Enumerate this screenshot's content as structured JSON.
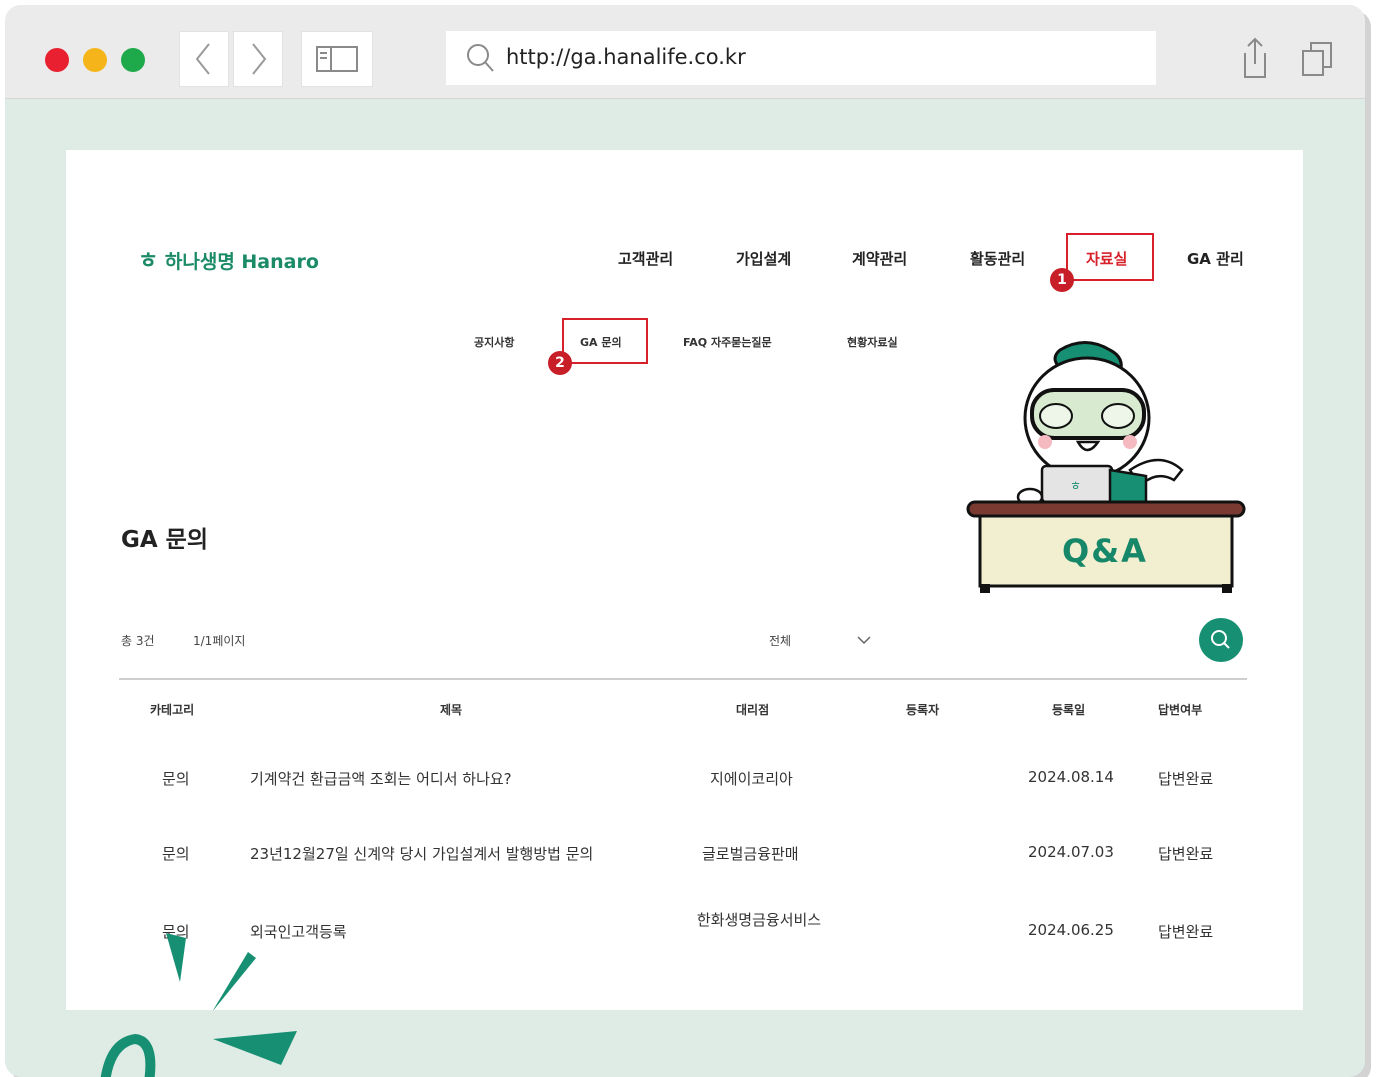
{
  "browser": {
    "url": "http://ga.hanalife.co.kr",
    "traffic_colors": [
      "#e8202f",
      "#f5b51a",
      "#1ea94b"
    ]
  },
  "site": {
    "logo_text": "하나생명 Hanaro",
    "nav": [
      "고객관리",
      "가입설계",
      "계약관리",
      "활동관리",
      "자료실",
      "GA 관리"
    ],
    "subnav": [
      "공지사항",
      "GA 문의",
      "FAQ 자주묻는질문",
      "현황자료실"
    ]
  },
  "markers": {
    "step1": "1",
    "step2": "2"
  },
  "board": {
    "title": "GA 문의",
    "total": "총 3건",
    "pages": "1/1페이지",
    "filter": "전체",
    "columns": [
      "카테고리",
      "제목",
      "대리점",
      "등록자",
      "등록일",
      "답변여부"
    ],
    "rows": [
      {
        "category": "문의",
        "subject": "기계약건 환급금액 조회는 어디서 하나요?",
        "agency": "지에이코리아",
        "writer": "",
        "date": "2024.08.14",
        "status": "답변완료"
      },
      {
        "category": "문의",
        "subject": "23년12월27일 신계약 당시 가입설계서 발행방법 문의",
        "agency": "글로벌금융판매",
        "writer": "",
        "date": "2024.07.03",
        "status": "답변완료"
      },
      {
        "category": "문의",
        "subject": "외국인고객등록",
        "agency": "한화생명금융서비스",
        "writer": "",
        "date": "2024.06.25",
        "status": "답변완료"
      }
    ]
  },
  "illustration": {
    "sign": "Q&A",
    "laptop_mark": "ㅎ"
  },
  "colors": {
    "accent": "#168f72",
    "highlight": "#d8202a",
    "background": "#dfece6"
  }
}
